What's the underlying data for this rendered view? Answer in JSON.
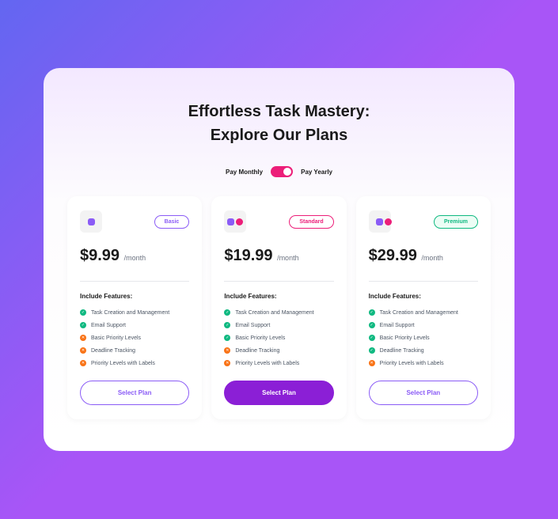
{
  "title": "Effortless Task Mastery: Explore Our Plans",
  "toggle": {
    "monthly": "Pay Monthly",
    "yearly": "Pay Yearly"
  },
  "featuresTitle": "Include Features:",
  "selectLabel": "Select Plan",
  "plans": [
    {
      "badge": "Basic",
      "price": "$9.99",
      "period": "/month",
      "features": [
        {
          "text": "Task Creation and Management",
          "included": true
        },
        {
          "text": "Email Support",
          "included": true
        },
        {
          "text": "Basic Priority Levels",
          "included": false
        },
        {
          "text": "Deadline Tracking",
          "included": false
        },
        {
          "text": "Priority Levels with Labels",
          "included": false
        }
      ]
    },
    {
      "badge": "Standard",
      "price": "$19.99",
      "period": "/month",
      "features": [
        {
          "text": "Task Creation and Management",
          "included": true
        },
        {
          "text": "Email Support",
          "included": true
        },
        {
          "text": "Basic Priority Levels",
          "included": true
        },
        {
          "text": "Deadline Tracking",
          "included": false
        },
        {
          "text": "Priority Levels with Labels",
          "included": false
        }
      ]
    },
    {
      "badge": "Premium",
      "price": "$29.99",
      "period": "/month",
      "features": [
        {
          "text": "Task Creation and Management",
          "included": true
        },
        {
          "text": "Email Support",
          "included": true
        },
        {
          "text": "Basic Priority Levels",
          "included": true
        },
        {
          "text": "Deadline Tracking",
          "included": true
        },
        {
          "text": "Priority Levels with Labels",
          "included": false
        }
      ]
    }
  ]
}
